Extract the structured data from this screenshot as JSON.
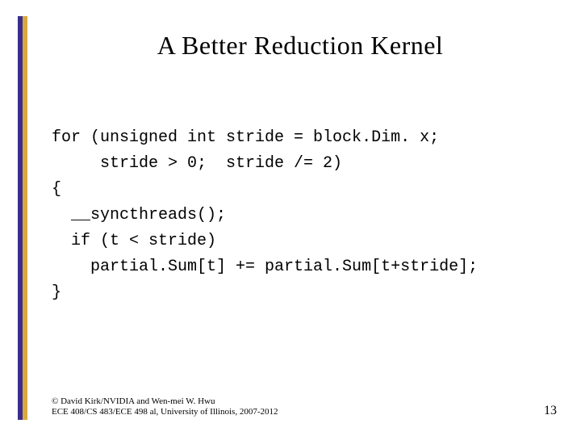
{
  "title": "A Better Reduction Kernel",
  "code": {
    "l1": "for (unsigned int stride = block.Dim. x;",
    "l2": "     stride > 0;  stride /= 2)",
    "l3": "{",
    "l4": "  __syncthreads();",
    "l5": "  if (t < stride)",
    "l6": "    partial.Sum[t] += partial.Sum[t+stride];",
    "l7": "}"
  },
  "footer": {
    "credit_line1": "© David Kirk/NVIDIA and Wen-mei W. Hwu",
    "credit_line2": "ECE 408/CS 483/ECE 498 al, University of Illinois, 2007-2012",
    "page": "13"
  }
}
